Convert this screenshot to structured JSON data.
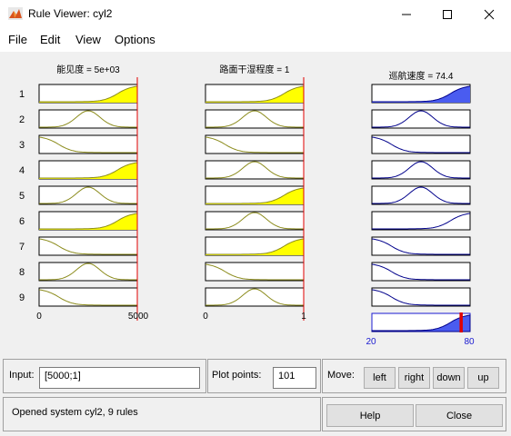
{
  "window": {
    "title": "Rule Viewer: cyl2",
    "minimize_icon": "minimize-icon",
    "maximize_icon": "maximize-icon",
    "close_icon": "close-icon"
  },
  "menu": [
    "File",
    "Edit",
    "View",
    "Options"
  ],
  "columns": [
    {
      "header": "能见度 = 5e+03",
      "axis_min": "0",
      "axis_max": "5000"
    },
    {
      "header": "路面干湿程度 = 1",
      "axis_min": "0",
      "axis_max": "1"
    },
    {
      "header": "巡航速度 = 74.4",
      "axis_min": "20",
      "axis_max": "80"
    }
  ],
  "rules": [
    {
      "num": "1",
      "in1": "high",
      "in2": "high",
      "out": "high",
      "fill1": 1.0,
      "fill2": 1.0,
      "fillOut": 1.0
    },
    {
      "num": "2",
      "in1": "mid",
      "in2": "mid",
      "out": "mid",
      "fill1": 0.0,
      "fill2": 0.0,
      "fillOut": 0.0
    },
    {
      "num": "3",
      "in1": "low",
      "in2": "low",
      "out": "low",
      "fill1": 0.0,
      "fill2": 0.0,
      "fillOut": 0.0
    },
    {
      "num": "4",
      "in1": "high",
      "in2": "mid",
      "out": "mid",
      "fill1": 1.0,
      "fill2": 0.0,
      "fillOut": 0.0
    },
    {
      "num": "5",
      "in1": "mid",
      "in2": "high",
      "out": "mid",
      "fill1": 0.0,
      "fill2": 1.0,
      "fillOut": 0.0
    },
    {
      "num": "6",
      "in1": "high",
      "in2": "mid",
      "out": "high",
      "fill1": 1.0,
      "fill2": 0.0,
      "fillOut": 0.0
    },
    {
      "num": "7",
      "in1": "low",
      "in2": "high",
      "out": "low",
      "fill1": 0.0,
      "fill2": 1.0,
      "fillOut": 0.0
    },
    {
      "num": "8",
      "in1": "mid",
      "in2": "low",
      "out": "low",
      "fill1": 0.0,
      "fill2": 0.0,
      "fillOut": 0.0
    },
    {
      "num": "9",
      "in1": "low",
      "in2": "mid",
      "out": "low",
      "fill1": 0.0,
      "fill2": 0.0,
      "fillOut": 0.0
    }
  ],
  "aggregate": {
    "crisp_output": 74.4,
    "range": [
      20,
      80
    ]
  },
  "colors": {
    "input_fill": "#ffff00",
    "output_fill": "#4a5cf0",
    "input_curve": "#8b8b1b",
    "output_curve": "#00008b",
    "marker": "#e00000"
  },
  "bottom": {
    "input_label": "Input:",
    "input_value": "[5000;1]",
    "plot_points_label": "Plot points:",
    "plot_points_value": "101",
    "move_label": "Move:",
    "move_buttons": [
      "left",
      "right",
      "down",
      "up"
    ],
    "status": "Opened system cyl2, 9 rules",
    "help": "Help",
    "close": "Close"
  }
}
